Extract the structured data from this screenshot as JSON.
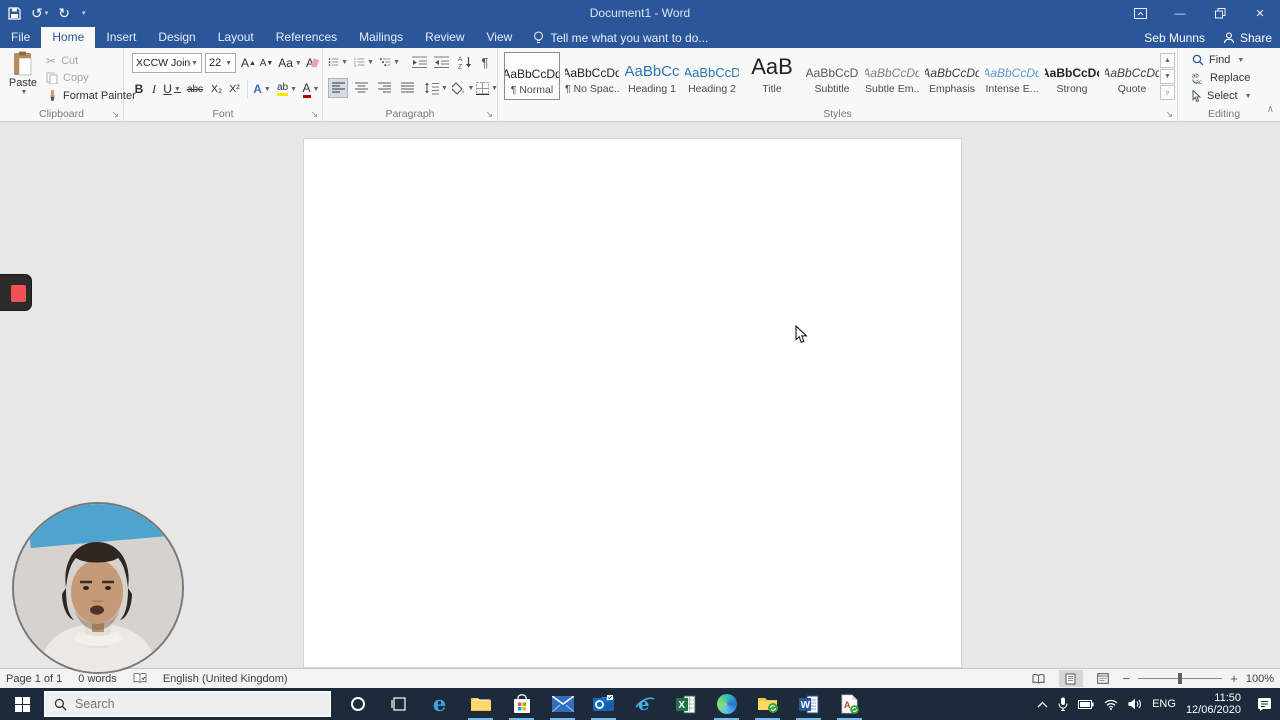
{
  "window": {
    "title": "Document1 - Word"
  },
  "tabs": {
    "items": [
      "File",
      "Home",
      "Insert",
      "Design",
      "Layout",
      "References",
      "Mailings",
      "Review",
      "View"
    ],
    "active": "Home",
    "tell_me": "Tell me what you want to do...",
    "user": "Seb Munns",
    "share": "Share"
  },
  "ribbon": {
    "clipboard": {
      "label": "Clipboard",
      "paste": "Paste",
      "cut": "Cut",
      "copy": "Copy",
      "format_painter": "Format Painter"
    },
    "font": {
      "label": "Font",
      "name": "XCCW Joined",
      "size": "22",
      "bold": "B",
      "italic": "I",
      "underline": "U",
      "strikethrough": "abc",
      "subscript": "X₂",
      "superscript": "X²",
      "change_case": "Aa",
      "grow": "A",
      "shrink": "A",
      "effects": "A",
      "highlight": "ab",
      "color": "A"
    },
    "paragraph": {
      "label": "Paragraph"
    },
    "styles": {
      "label": "Styles",
      "items": [
        {
          "preview": "AaBbCcDd",
          "name": "¶ Normal"
        },
        {
          "preview": "AaBbCcDd",
          "name": "¶ No Spac..."
        },
        {
          "preview": "AaBbCc",
          "name": "Heading 1"
        },
        {
          "preview": "AaBbCcD",
          "name": "Heading 2"
        },
        {
          "preview": "AaB",
          "name": "Title"
        },
        {
          "preview": "AaBbCcD",
          "name": "Subtitle"
        },
        {
          "preview": "AaBbCcDd",
          "name": "Subtle Em..."
        },
        {
          "preview": "AaBbCcDd",
          "name": "Emphasis"
        },
        {
          "preview": "AaBbCcDd",
          "name": "Intense E..."
        },
        {
          "preview": "AaBbCcDc",
          "name": "Strong"
        },
        {
          "preview": "AaBbCcDd",
          "name": "Quote"
        }
      ]
    },
    "editing": {
      "label": "Editing",
      "find": "Find",
      "replace": "Replace",
      "select": "Select"
    }
  },
  "statusbar": {
    "page": "Page 1 of 1",
    "words": "0 words",
    "language": "English (United Kingdom)",
    "zoom_level": "100%"
  },
  "taskbar": {
    "search_placeholder": "Search",
    "apps": [
      "edge-legacy",
      "file-explorer",
      "microsoft-store",
      "mail",
      "outlook",
      "internet-explorer",
      "excel",
      "edge",
      "file-explorer-sync",
      "word",
      "acrobat"
    ],
    "language": "ENG",
    "time": "11:50",
    "date": "12/06/2020"
  },
  "colors": {
    "accent": "#2b579a",
    "taskbar": "#1d2a3a",
    "heading_blue": "#2e74b5",
    "canvas": "#e7e7e7"
  }
}
